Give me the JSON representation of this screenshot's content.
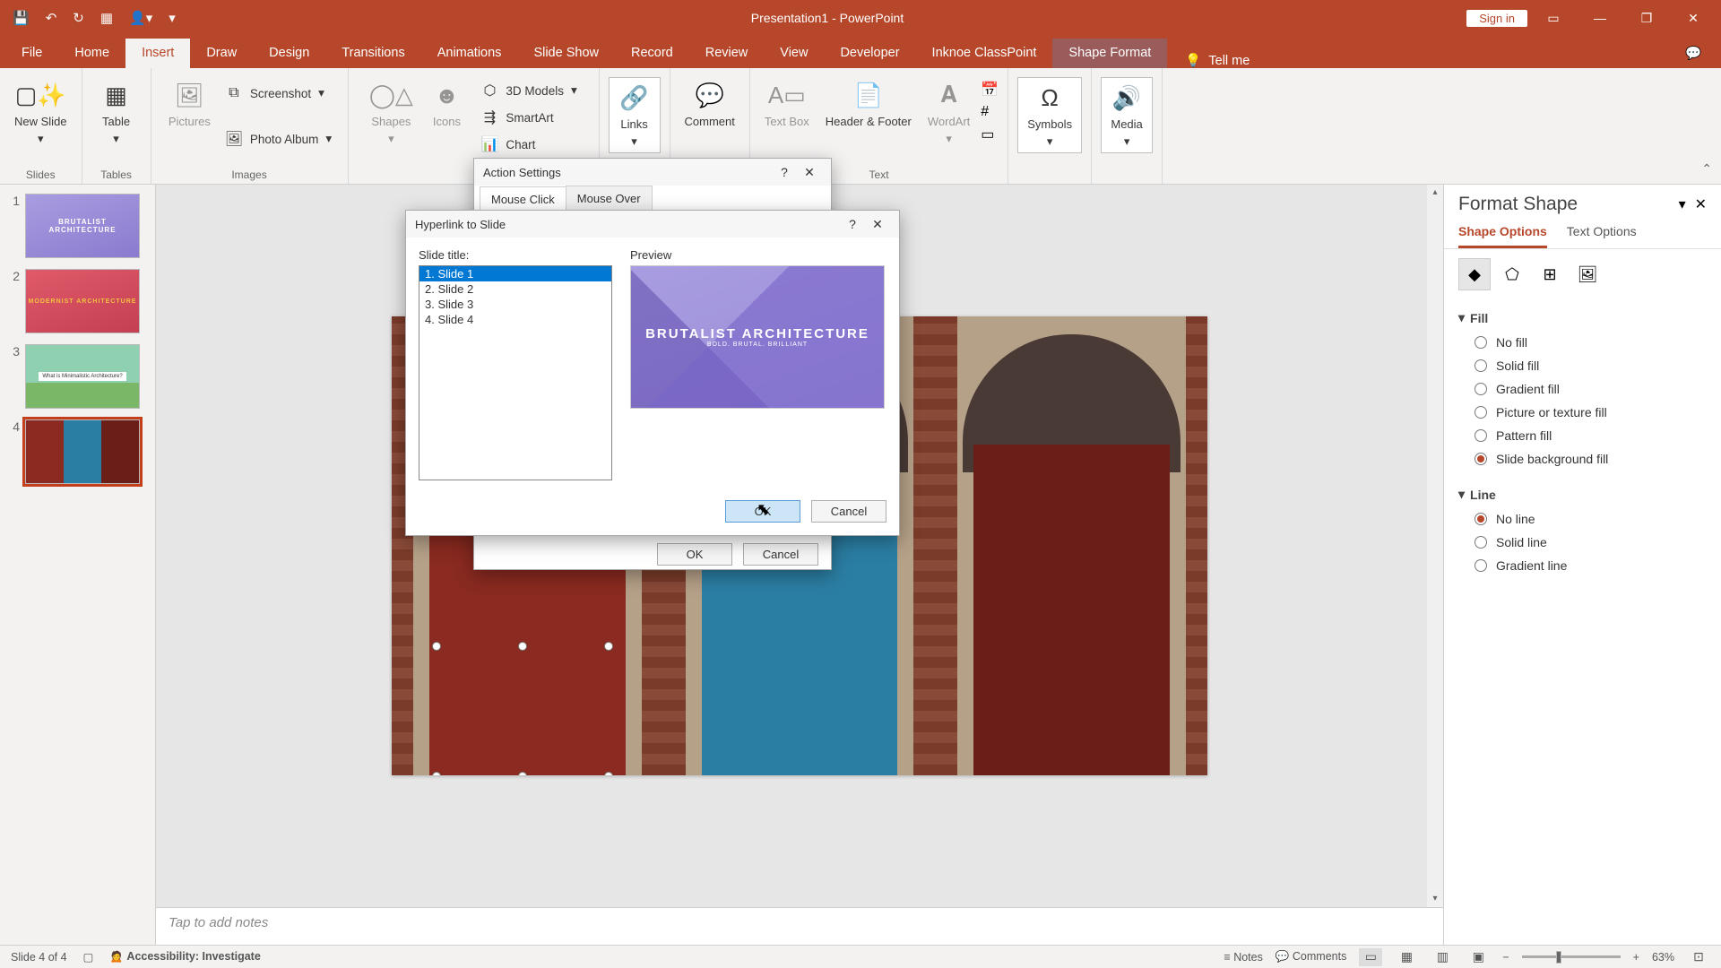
{
  "title_bar": {
    "app_title": "Presentation1  -  PowerPoint",
    "sign_in": "Sign in"
  },
  "tabs": {
    "file": "File",
    "home": "Home",
    "insert": "Insert",
    "draw": "Draw",
    "design": "Design",
    "transitions": "Transitions",
    "animations": "Animations",
    "slideshow": "Slide Show",
    "record": "Record",
    "review": "Review",
    "view": "View",
    "developer": "Developer",
    "classpoint": "Inknoe ClassPoint",
    "shape_format": "Shape Format",
    "tell_me": "Tell me"
  },
  "ribbon": {
    "new_slide": "New Slide",
    "table": "Table",
    "pictures": "Pictures",
    "screenshot": "Screenshot",
    "photo_album": "Photo Album",
    "shapes": "Shapes",
    "icons": "Icons",
    "models3d": "3D Models",
    "smartart": "SmartArt",
    "chart": "Chart",
    "links": "Links",
    "comment": "Comment",
    "text_box": "Text Box",
    "header_footer": "Header & Footer",
    "wordart": "WordArt",
    "symbols": "Symbols",
    "media": "Media",
    "group_slides": "Slides",
    "group_tables": "Tables",
    "group_images": "Images",
    "group_text": "Text"
  },
  "thumbs": [
    "1",
    "2",
    "3",
    "4"
  ],
  "notes_placeholder": "Tap to add notes",
  "format_shape": {
    "title": "Format Shape",
    "tab_shape": "Shape Options",
    "tab_text": "Text Options",
    "fill": "Fill",
    "no_fill": "No fill",
    "solid_fill": "Solid fill",
    "gradient_fill": "Gradient fill",
    "picture_fill": "Picture or texture fill",
    "pattern_fill": "Pattern fill",
    "slide_bg_fill": "Slide background fill",
    "line": "Line",
    "no_line": "No line",
    "solid_line": "Solid line",
    "gradient_line": "Gradient line"
  },
  "action_dialog": {
    "title": "Action Settings",
    "tab_click": "Mouse Click",
    "tab_over": "Mouse Over",
    "ok": "OK",
    "cancel": "Cancel"
  },
  "hyperlink_dialog": {
    "title": "Hyperlink to Slide",
    "slide_title_label": "Slide title:",
    "preview_label": "Preview",
    "items": [
      "1. Slide 1",
      "2. Slide 2",
      "3. Slide 3",
      "4. Slide 4"
    ],
    "preview_main": "BRUTALIST ARCHITECTURE",
    "preview_sub": "BOLD. BRUTAL. BRILLIANT",
    "ok": "OK",
    "cancel": "Cancel"
  },
  "status": {
    "slide_of": "Slide 4 of 4",
    "accessibility": "Accessibility: Investigate",
    "notes": "Notes",
    "comments": "Comments",
    "zoom": "63%"
  },
  "thumb_text": {
    "t1": "BRUTALIST ARCHITECTURE",
    "t2": "MODERNIST ARCHITECTURE",
    "t3": "What is Minimalistic Architecture?"
  }
}
